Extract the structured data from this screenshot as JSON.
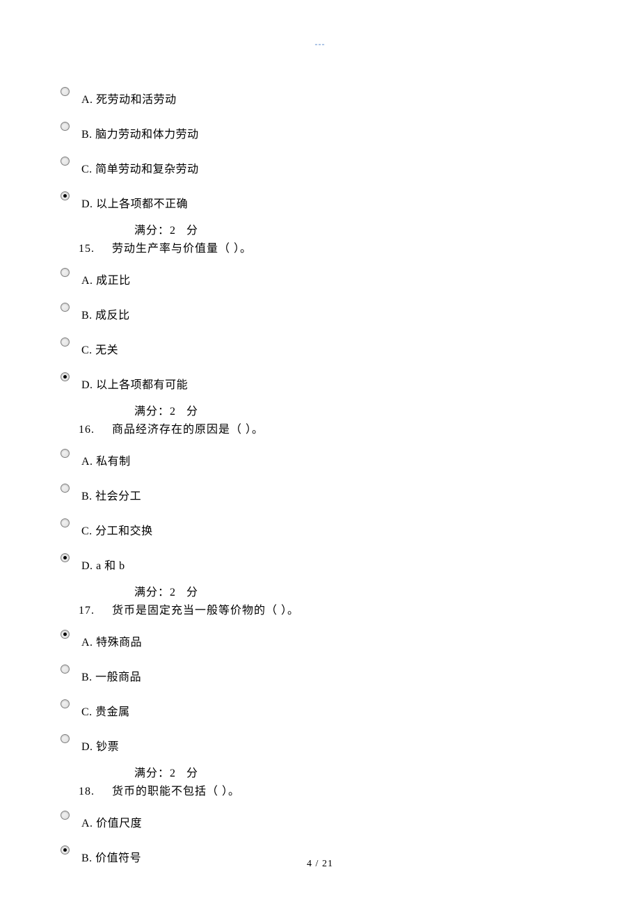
{
  "header_mark": "---",
  "questions": [
    {
      "number": "15.",
      "text": "劳动生产率与价值量（ ）。",
      "score_label": "满分：2",
      "score_unit": "分",
      "options": [
        {
          "letter": "A.",
          "text": "死劳动和活劳动",
          "selected": false
        },
        {
          "letter": "B.",
          "text": "脑力劳动和体力劳动",
          "selected": false
        },
        {
          "letter": "C.",
          "text": "简单劳动和复杂劳动",
          "selected": false
        },
        {
          "letter": "D.",
          "text": "以上各项都不正确",
          "selected": true
        }
      ],
      "next_options": [
        {
          "letter": "A.",
          "text": "成正比",
          "selected": false
        },
        {
          "letter": "B.",
          "text": "成反比",
          "selected": false
        },
        {
          "letter": "C.",
          "text": "无关",
          "selected": false
        },
        {
          "letter": "D.",
          "text": "以上各项都有可能",
          "selected": true
        }
      ]
    },
    {
      "number": "16.",
      "text": "商品经济存在的原因是（ ）。",
      "score_label": "满分：2",
      "score_unit": "分",
      "options": [
        {
          "letter": "A.",
          "text": "私有制",
          "selected": false
        },
        {
          "letter": "B.",
          "text": "社会分工",
          "selected": false
        },
        {
          "letter": "C.",
          "text": "分工和交换",
          "selected": false
        },
        {
          "letter": "D.",
          "text": "a 和 b",
          "selected": true
        }
      ]
    },
    {
      "number": "17.",
      "text": "货币是固定充当一般等价物的（ ）。",
      "score_label": "满分：2",
      "score_unit": "分",
      "options": [
        {
          "letter": "A.",
          "text": "特殊商品",
          "selected": true
        },
        {
          "letter": "B.",
          "text": "一般商品",
          "selected": false
        },
        {
          "letter": "C.",
          "text": "贵金属",
          "selected": false
        },
        {
          "letter": "D.",
          "text": "钞票",
          "selected": false
        }
      ]
    },
    {
      "number": "18.",
      "text": "货币的职能不包括（ ）。",
      "score_label": "满分：2",
      "score_unit": "分",
      "options": [
        {
          "letter": "A.",
          "text": "价值尺度",
          "selected": false
        },
        {
          "letter": "B.",
          "text": "价值符号",
          "selected": true
        }
      ]
    }
  ],
  "footer": "4 / 21"
}
